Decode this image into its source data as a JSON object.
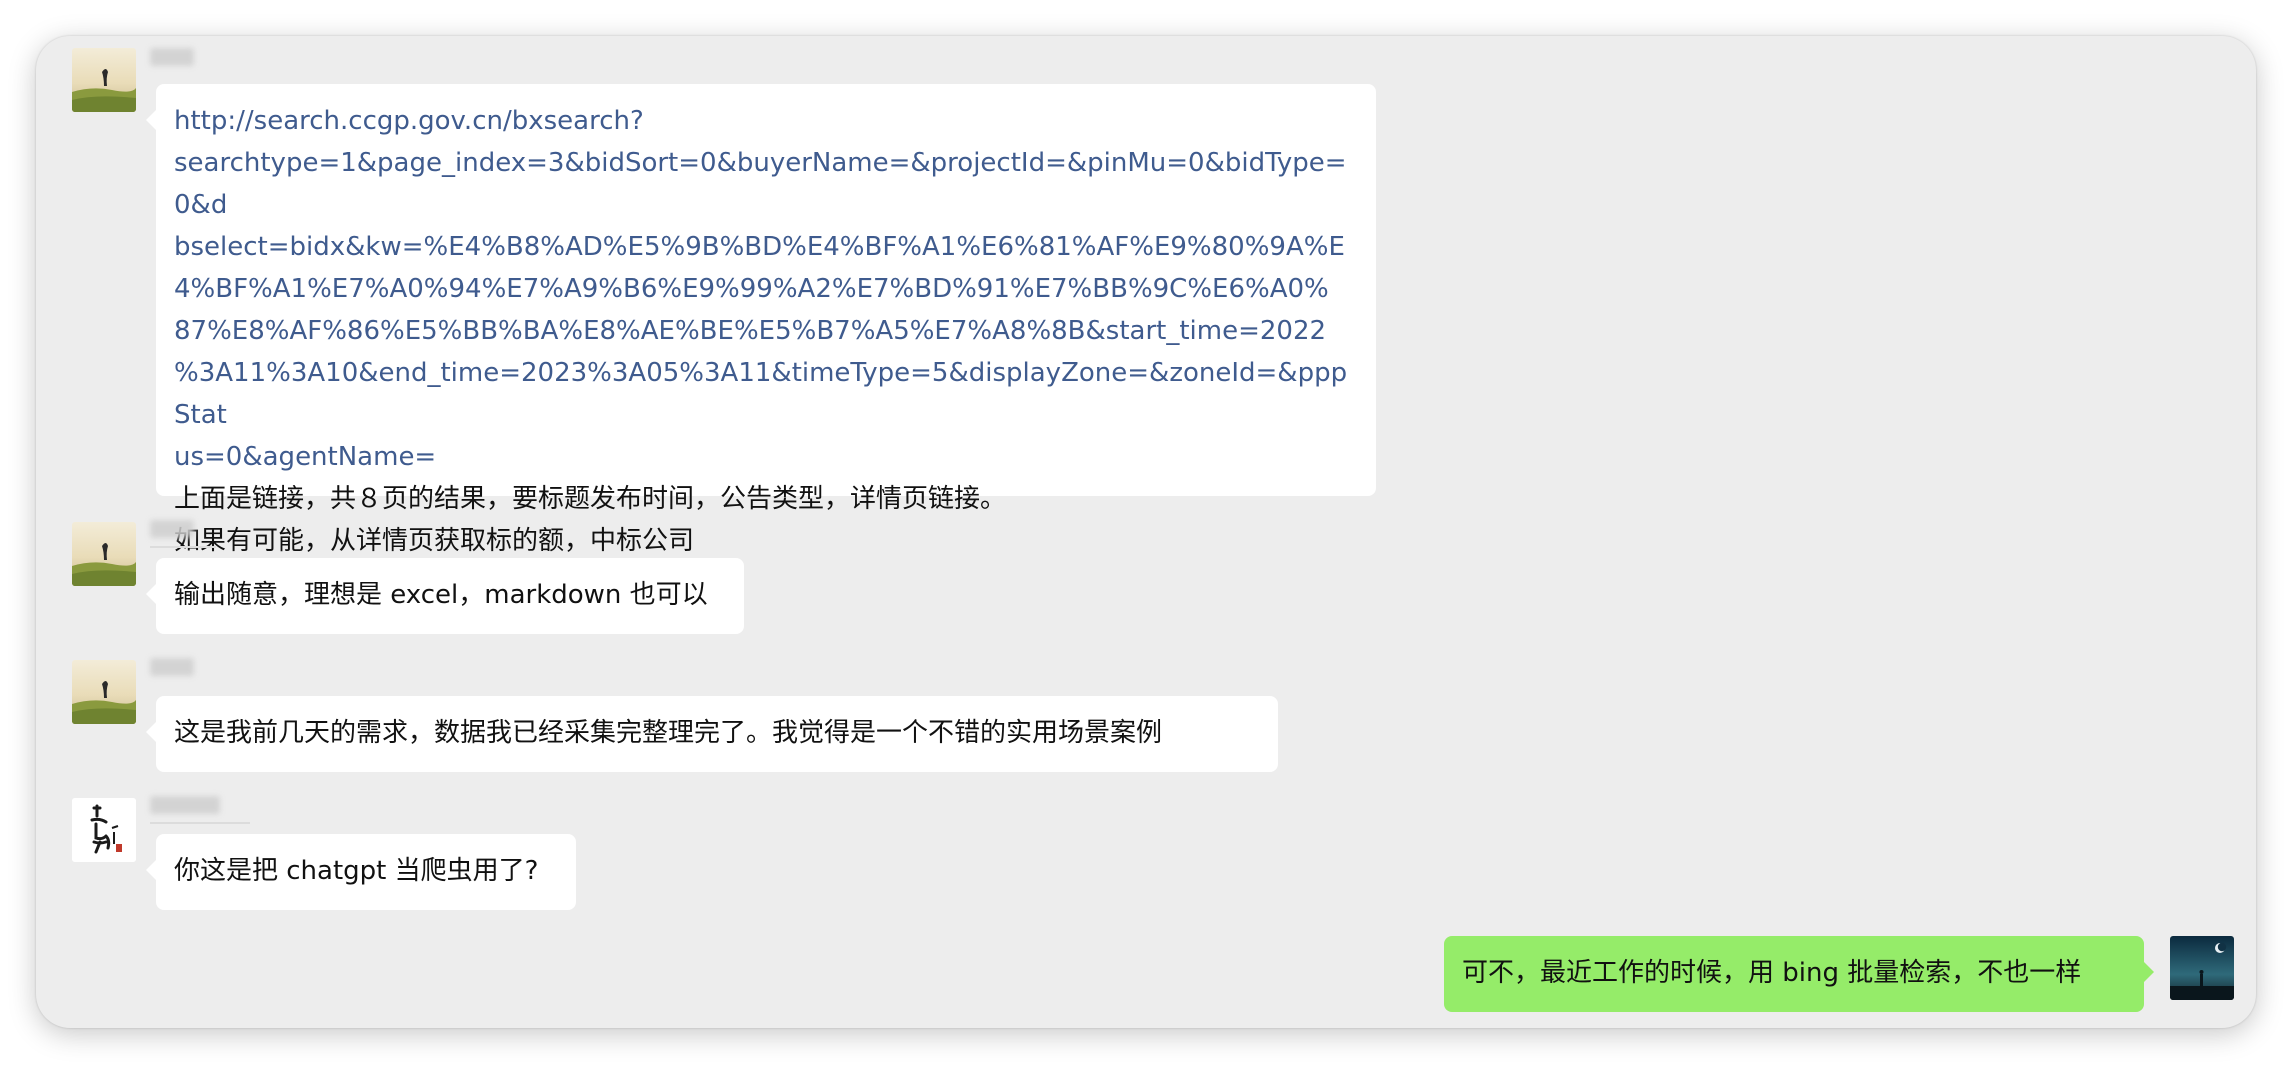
{
  "messages": [
    {
      "sender": "other",
      "link": "http://search.ccgp.gov.cn/bxsearch?searchtype=1&page_index=3&bidSort=0&buyerName=&projectId=&pinMu=0&bidType=0&dbselect=bidx&kw=%E4%B8%AD%E5%9B%BD%E4%BF%A1%E6%81%AF%E9%80%9A%E4%BF%A1%E7%A0%94%E7%A9%B6%E9%99%A2%E7%BD%91%E7%BB%9C%E6%A0%87%E8%AF%86%E5%BB%BA%E8%AE%BE%E5%B7%A5%E7%A8%8B&start_time=2022%3A11%3A10&end_time=2023%3A05%3A11&timeType=5&displayZone=&zoneId=&pppStatus=0&agentName=",
      "link_lines": [
        "http://search.ccgp.gov.cn/bxsearch?",
        "searchtype=1&page_index=3&bidSort=0&buyerName=&projectId=&pinMu=0&bidType=0&d",
        "bselect=bidx&kw=%E4%B8%AD%E5%9B%BD%E4%BF%A1%E6%81%AF%E9%80%9A%E",
        "4%BF%A1%E7%A0%94%E7%A9%B6%E9%99%A2%E7%BD%91%E7%BB%9C%E6%A0%",
        "87%E8%AF%86%E5%BB%BA%E8%AE%BE%E5%B7%A5%E7%A8%8B&start_time=2022",
        "%3A11%3A10&end_time=2023%3A05%3A11&timeType=5&displayZone=&zoneId=&pppStat",
        "us=0&agentName="
      ],
      "text_lines": [
        "上面是链接，共８页的结果，要标题发布时间，公告类型，详情页链接。",
        "如果有可能，从详情页获取标的额，中标公司"
      ]
    },
    {
      "sender": "other",
      "text": "输出随意，理想是 excel，markdown 也可以"
    },
    {
      "sender": "other",
      "text": "这是我前几天的需求，数据我已经采集完整理完了。我觉得是一个不错的实用场景案例"
    },
    {
      "sender": "other2",
      "text": "你这是把 chatgpt 当爬虫用了?"
    },
    {
      "sender": "me",
      "text": "可不，最近工作的时候，用 bing 批量检索，不也一样"
    }
  ],
  "colors": {
    "window_bg": "#ededed",
    "bubble_other": "#ffffff",
    "bubble_me": "#95ec69",
    "link": "#3f5b8e"
  }
}
